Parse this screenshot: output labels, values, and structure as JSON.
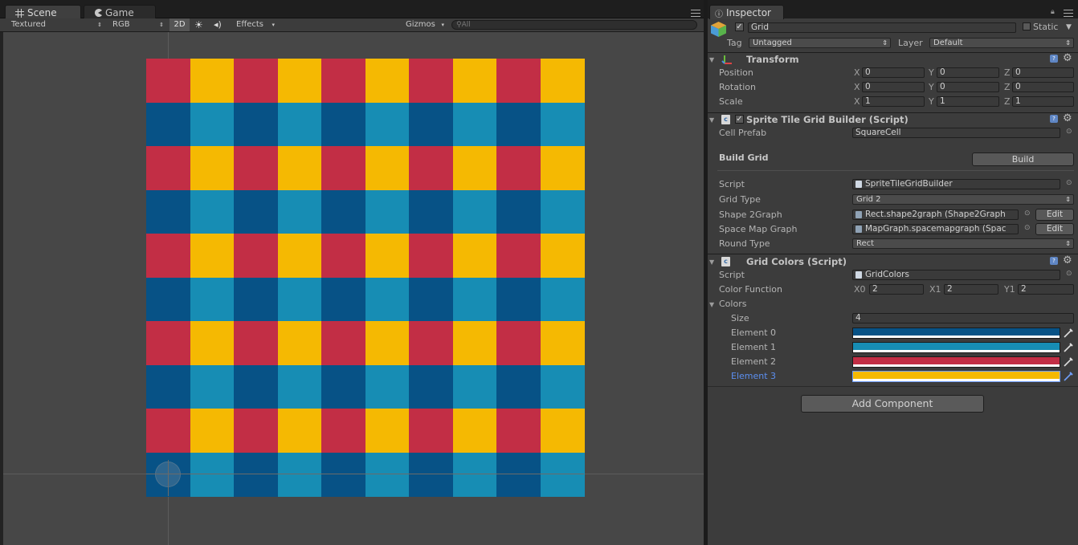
{
  "scene_tabs": {
    "scene": "Scene",
    "game": "Game",
    "menu_icon": "hamburger-icon"
  },
  "scene_toolbar": {
    "shading": "Textured",
    "channel": "RGB",
    "mode2d": "2D",
    "sun_icon": "sun-icon",
    "audio_icon": "speaker-icon",
    "effects": "Effects",
    "gizmos": "Gizmos",
    "search_placeholder": "All"
  },
  "grid": {
    "rows": 10,
    "cols": 10,
    "palette": {
      "dark_blue": "#075286",
      "light_blue": "#178db4",
      "red": "#c22e45",
      "yellow": "#f5b902"
    },
    "row_pattern": [
      [
        "red",
        "yellow"
      ],
      [
        "dark_blue",
        "light_blue"
      ]
    ]
  },
  "inspector": {
    "tab": "Inspector",
    "object": {
      "name": "Grid",
      "active": true,
      "static_label": "Static",
      "tag_label": "Tag",
      "tag_value": "Untagged",
      "layer_label": "Layer",
      "layer_value": "Default"
    },
    "transform": {
      "title": "Transform",
      "rows": [
        {
          "label": "Position",
          "x": "0",
          "y": "0",
          "z": "0"
        },
        {
          "label": "Rotation",
          "x": "0",
          "y": "0",
          "z": "0"
        },
        {
          "label": "Scale",
          "x": "1",
          "y": "1",
          "z": "1"
        }
      ]
    },
    "builder": {
      "title": "Sprite Tile Grid Builder (Script)",
      "cell_prefab_label": "Cell Prefab",
      "cell_prefab_value": "SquareCell",
      "build_grid_label": "Build Grid",
      "build_button": "Build",
      "script_label": "Script",
      "script_value": "SpriteTileGridBuilder",
      "grid_type_label": "Grid Type",
      "grid_type_value": "Grid 2",
      "shape_label": "Shape 2Graph",
      "shape_value": "Rect.shape2graph (Shape2Graph",
      "space_label": "Space Map Graph",
      "space_value": "MapGraph.spacemapgraph (Spac",
      "edit_label": "Edit",
      "round_label": "Round Type",
      "round_value": "Rect"
    },
    "colors": {
      "title": "Grid Colors (Script)",
      "script_label": "Script",
      "script_value": "GridColors",
      "func_label": "Color Function",
      "x0_label": "X0",
      "x0": "2",
      "x1_label": "X1",
      "x1": "2",
      "y1_label": "Y1",
      "y1": "2",
      "colors_label": "Colors",
      "size_label": "Size",
      "size_value": "4",
      "elements": [
        {
          "label": "Element 0",
          "color": "#075286"
        },
        {
          "label": "Element 1",
          "color": "#178db4"
        },
        {
          "label": "Element 2",
          "color": "#c22e45"
        },
        {
          "label": "Element 3",
          "color": "#f5b902"
        }
      ]
    },
    "add_component": "Add Component"
  }
}
